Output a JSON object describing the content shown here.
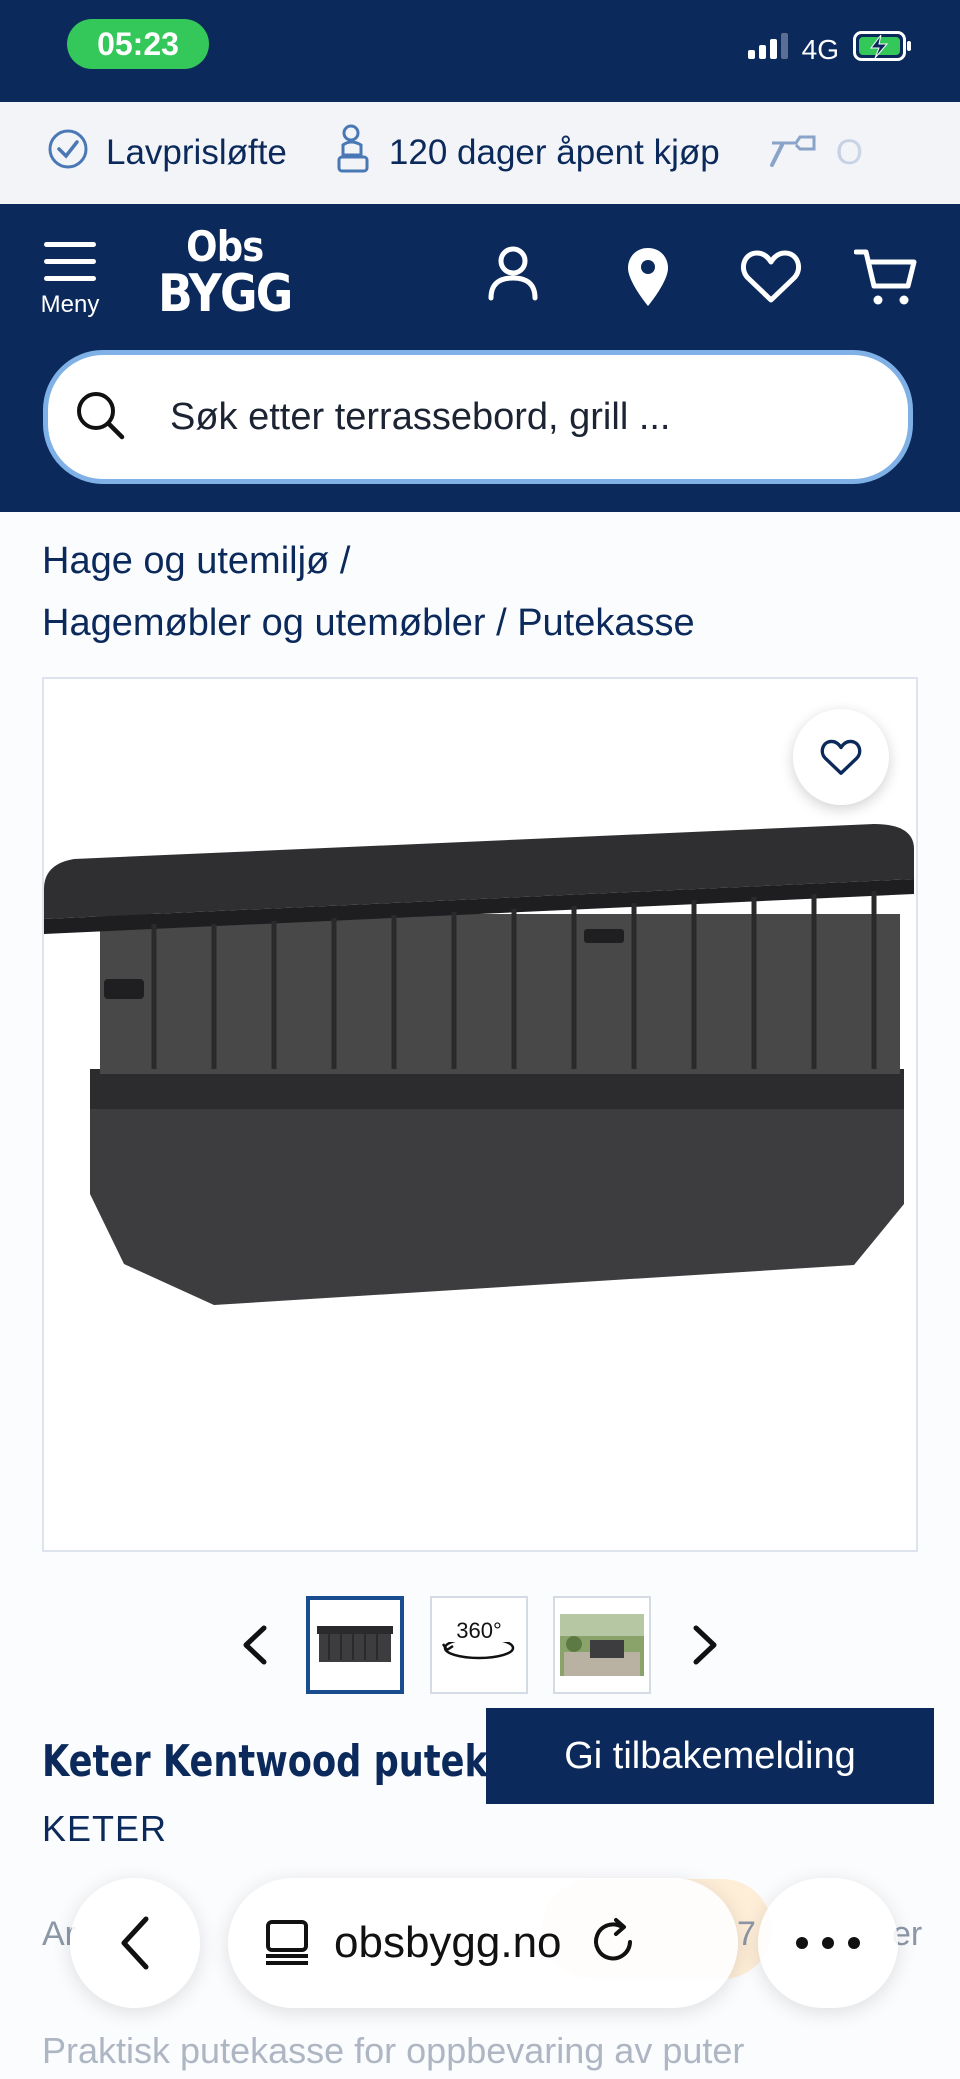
{
  "status_bar": {
    "time": "05:23",
    "network": "4G"
  },
  "usp_bar": {
    "items": [
      {
        "icon": "check-badge-icon",
        "label": "Lavprisløfte"
      },
      {
        "icon": "return-box-icon",
        "label": "120 dager åpent kjøp"
      },
      {
        "icon": "tools-icon",
        "label": "O"
      }
    ]
  },
  "header": {
    "menu_label": "Meny",
    "logo": {
      "line1": "Obs",
      "line2": "BYGG"
    },
    "search_placeholder": "Søk etter terrassebord, grill ..."
  },
  "breadcrumb": {
    "items": [
      "Hage og utemiljø",
      "Hagemøbler og utemøbler",
      "Putekasse"
    ],
    "separator": "/"
  },
  "gallery": {
    "thumbnails": [
      "product-photo",
      "360-view",
      "lifestyle-photo"
    ],
    "active_index": 0,
    "thumb_360_label": "360°"
  },
  "product": {
    "title": "Keter Kentwood puteka",
    "brand": "KETER"
  },
  "feedback_button": "Gi tilbakemelding",
  "faded_row": {
    "left": "Ar",
    "mid": "7",
    "right": "er"
  },
  "description_start": "Praktisk putekasse for oppbevaring av puter",
  "browser": {
    "url": "obsbygg.no"
  },
  "colors": {
    "navy": "#0b2a5b",
    "status_green": "#34c759",
    "search_border": "#7fb0e6"
  }
}
